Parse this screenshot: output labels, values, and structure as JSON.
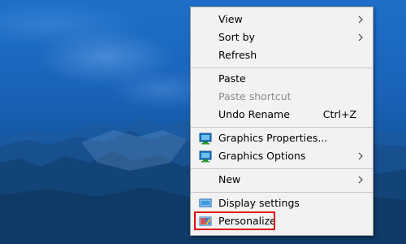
{
  "context_menu": {
    "view": {
      "label": "View"
    },
    "sort_by": {
      "label": "Sort by"
    },
    "refresh": {
      "label": "Refresh"
    },
    "paste": {
      "label": "Paste"
    },
    "paste_shortcut": {
      "label": "Paste shortcut"
    },
    "undo_rename": {
      "label": "Undo Rename",
      "shortcut": "Ctrl+Z"
    },
    "graphics_properties": {
      "label": "Graphics Properties...",
      "icon": "intel-graphics-icon"
    },
    "graphics_options": {
      "label": "Graphics Options",
      "icon": "intel-graphics-icon"
    },
    "new": {
      "label": "New"
    },
    "display_settings": {
      "label": "Display settings",
      "icon": "display-icon"
    },
    "personalize": {
      "label": "Personalize",
      "icon": "personalize-icon"
    }
  },
  "annotation": {
    "highlight_color": "#e01010"
  }
}
